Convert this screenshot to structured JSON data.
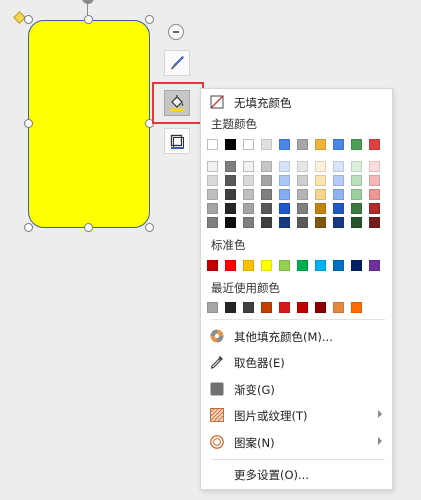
{
  "fill_menu": {
    "no_fill": "无填充颜色",
    "theme_colors_title": "主题颜色",
    "standard_colors_title": "标准色",
    "recent_colors_title": "最近使用颜色",
    "more_fill_colors": "其他填充颜色(M)...",
    "eyedropper": "取色器(E)",
    "gradient": "渐变(G)",
    "picture_texture": "图片或纹理(T)",
    "pattern": "图案(N)",
    "more_settings": "更多设置(O)..."
  },
  "shape": {
    "fill_color": "#ffff00",
    "outline_color": "#3a5ea8"
  },
  "colors": {
    "theme_top": [
      "#ffffff",
      "#000000",
      "#ffffff",
      "#e0e0e0",
      "#4a86e8",
      "#a6a6a6",
      "#f0b23b",
      "#4a86e8",
      "#4e9e56",
      "#e04040"
    ],
    "theme_shades": [
      [
        "#f2f2f2",
        "#7f7f7f",
        "#f2f2f2",
        "#c7c7c7",
        "#d6e3fb",
        "#e6e6e6",
        "#fdf1d8",
        "#d9e5fb",
        "#dcefdd",
        "#fadcdc"
      ],
      [
        "#d9d9d9",
        "#595959",
        "#d9d9d9",
        "#a5a5a5",
        "#adc8f6",
        "#cfcfcf",
        "#fbe3b1",
        "#b4cbf6",
        "#bbe0bd",
        "#f5b8b8"
      ],
      [
        "#bfbfbf",
        "#3f3f3f",
        "#bfbfbf",
        "#7f7f7f",
        "#85adf1",
        "#b5b5b5",
        "#f8d58a",
        "#8fb2f1",
        "#99d19c",
        "#f09494"
      ],
      [
        "#a5a5a5",
        "#262626",
        "#a5a5a5",
        "#595959",
        "#1f58c8",
        "#7f7f7f",
        "#c28214",
        "#2058c8",
        "#3a7a40",
        "#b02a2a"
      ],
      [
        "#7f7f7f",
        "#0d0d0d",
        "#7f7f7f",
        "#3f3f3f",
        "#153b85",
        "#595959",
        "#81560d",
        "#153b85",
        "#27522b",
        "#751c1c"
      ]
    ],
    "standard": [
      "#c00000",
      "#ff0000",
      "#ffc000",
      "#ffff00",
      "#92d050",
      "#00b050",
      "#00b0f0",
      "#0070c0",
      "#002060",
      "#7030a0"
    ],
    "recent": [
      "#a6a6a6",
      "#262626",
      "#3f3f3f",
      "#c43e00",
      "#d61a1a",
      "#c00000",
      "#8b0000",
      "#e8873a",
      "#ff6a00"
    ]
  }
}
